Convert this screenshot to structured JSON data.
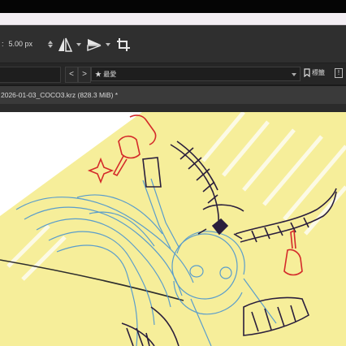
{
  "toolbar": {
    "size_separator": ":",
    "brush_size": "5.00 px",
    "icons": [
      "flip-horizontal-icon",
      "flip-vertical-icon",
      "crop-icon"
    ]
  },
  "navbar": {
    "prev": "<",
    "next": ">",
    "favorites_label": "★ 最愛",
    "bookmark_label": "標籤",
    "warning": "!"
  },
  "document": {
    "tab_title": "2026-01-03_COCO3.krz (828.3 MiB) *"
  },
  "colors": {
    "toolbar_bg": "#2f2f2f",
    "canvas_yellow": "#f6ee9a",
    "sketch_blue": "#3f8fd4",
    "sketch_dark": "#2a1e3c",
    "sketch_red": "#d42a2a"
  }
}
